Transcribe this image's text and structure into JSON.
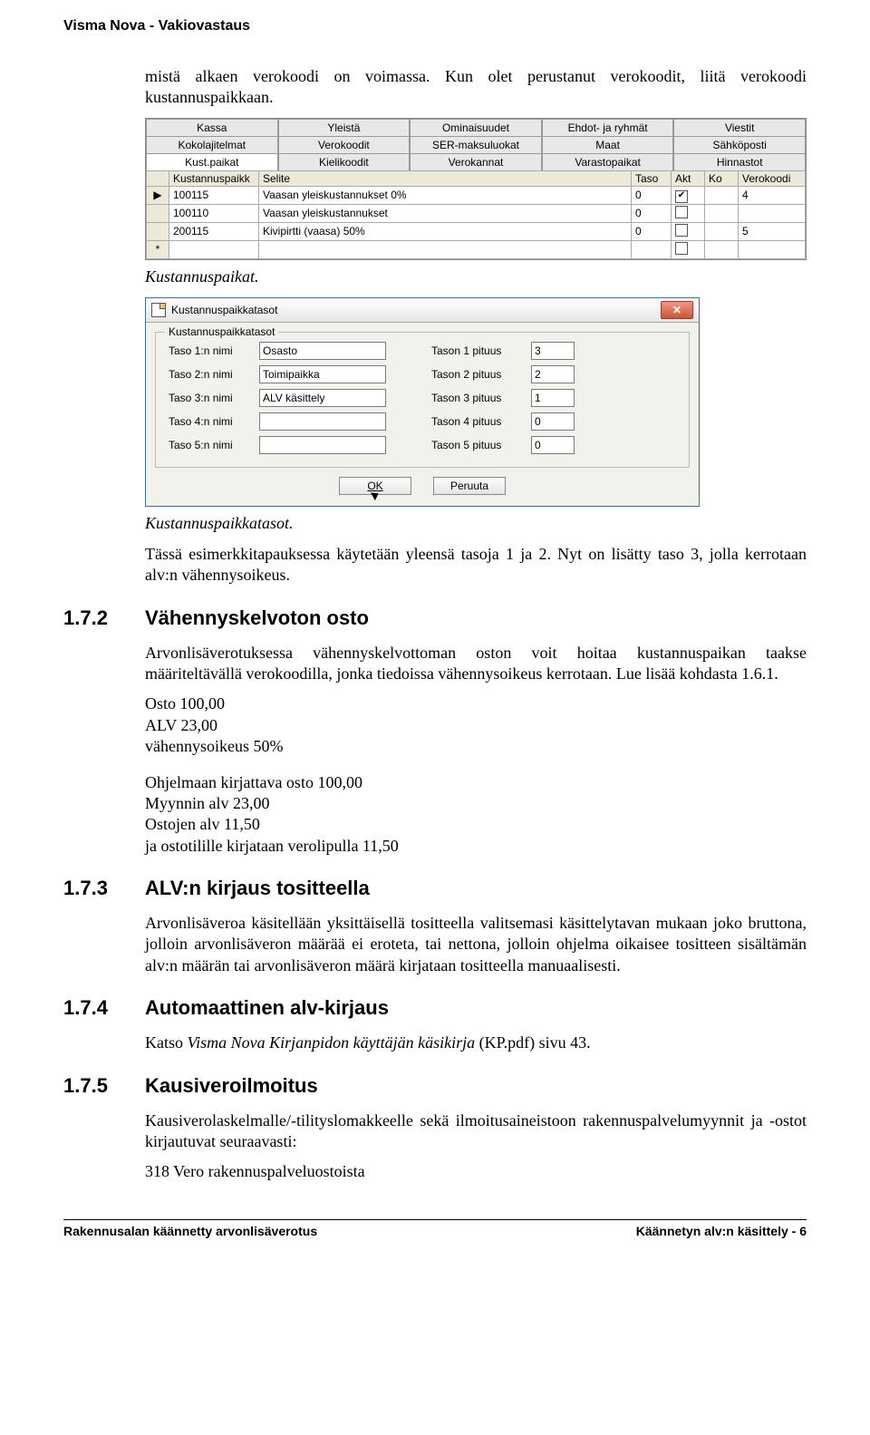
{
  "docHeader": "Visma Nova - Vakiovastaus",
  "intro": "mistä alkaen verokoodi on voimassa. Kun olet perustanut verokoodit, liitä verokoodi kustannuspaikkaan.",
  "screenshot1": {
    "tabs_row1": [
      "Kassa",
      "Yleistä",
      "Ominaisuudet",
      "Ehdot- ja ryhmät",
      "Viestit"
    ],
    "tabs_row2": [
      "Kokolajitelmat",
      "Verokoodit",
      "SER-maksuluokat",
      "Maat",
      "Sähköposti"
    ],
    "tabs_row3": [
      "Kust.paikat",
      "Kielikoodit",
      "Verokannat",
      "Varastopaikat",
      "Hinnastot"
    ],
    "selectedTab": "Kust.paikat",
    "columns": [
      "Kustannuspaikk",
      "Selite",
      "Taso",
      "Akt",
      "Ko",
      "Verokoodi"
    ],
    "rows": [
      {
        "kust": "100115",
        "selite": "Vaasan yleiskustannukset 0%",
        "taso": "0",
        "akt": true,
        "ko": "",
        "vero": "4",
        "marker": "▶"
      },
      {
        "kust": "100110",
        "selite": "Vaasan yleiskustannukset",
        "taso": "0",
        "akt": false,
        "ko": "",
        "vero": "",
        "marker": ""
      },
      {
        "kust": "200115",
        "selite": "Kivipirtti (vaasa) 50%",
        "taso": "0",
        "akt": false,
        "ko": "",
        "vero": "5",
        "marker": ""
      },
      {
        "kust": "",
        "selite": "",
        "taso": "",
        "akt": false,
        "ko": "",
        "vero": "",
        "marker": "*"
      }
    ]
  },
  "caption1": "Kustannuspaikat.",
  "dialog": {
    "title": "Kustannuspaikkatasot",
    "group": "Kustannuspaikkatasot",
    "rows": [
      {
        "nameLabel": "Taso 1:n nimi",
        "nameVal": "Osasto",
        "lenLabel": "Tason 1 pituus",
        "lenVal": "3"
      },
      {
        "nameLabel": "Taso 2:n nimi",
        "nameVal": "Toimipaikka",
        "lenLabel": "Tason 2 pituus",
        "lenVal": "2"
      },
      {
        "nameLabel": "Taso 3:n nimi",
        "nameVal": "ALV käsittely",
        "lenLabel": "Tason 3 pituus",
        "lenVal": "1"
      },
      {
        "nameLabel": "Taso 4:n nimi",
        "nameVal": "",
        "lenLabel": "Tason 4 pituus",
        "lenVal": "0"
      },
      {
        "nameLabel": "Taso 5:n nimi",
        "nameVal": "",
        "lenLabel": "Tason 5 pituus",
        "lenVal": "0"
      }
    ],
    "ok": "OK",
    "cancel": "Peruuta"
  },
  "caption2": "Kustannuspaikkatasot.",
  "para_tassa": "Tässä esimerkkitapauksessa käytetään yleensä tasoja 1 ja 2. Nyt on lisätty taso 3, jolla kerrotaan alv:n vähennysoikeus.",
  "s172": {
    "num": "1.7.2",
    "title": "Vähennyskelvoton osto",
    "p1": "Arvonlisäverotuksessa vähennyskelvottoman oston voit hoitaa kustannuspaikan taakse määriteltävällä verokoodilla, jonka tiedoissa vähennysoikeus kerrotaan. Lue lisää kohdasta 1.6.1.",
    "list1": [
      "Osto 100,00",
      "ALV 23,00",
      "vähennysoikeus 50%"
    ],
    "list2": [
      "Ohjelmaan kirjattava osto 100,00",
      "Myynnin alv 23,00",
      "Ostojen alv 11,50",
      "ja ostotilille kirjataan verolipulla 11,50"
    ]
  },
  "s173": {
    "num": "1.7.3",
    "title": "ALV:n kirjaus tositteella",
    "p1": "Arvonlisäveroa käsitellään yksittäisellä tositteella valitsemasi käsittelytavan mukaan joko bruttona, jolloin arvonlisäveron määrää ei eroteta, tai nettona, jolloin ohjelma oikaisee tositteen sisältämän alv:n määrän tai arvonlisäveron määrä kirjataan tositteella manuaalisesti."
  },
  "s174": {
    "num": "1.7.4",
    "title": "Automaattinen alv-kirjaus",
    "p1_prefix": "Katso ",
    "p1_em": "Visma Nova Kirjanpidon käyttäjän käsikirja",
    "p1_suffix": " (KP.pdf) sivu 43."
  },
  "s175": {
    "num": "1.7.5",
    "title": "Kausiveroilmoitus",
    "p1": "Kausiverolaskelmalle/-tilityslomakkeelle sekä ilmoitusaineistoon rakennuspalvelumyynnit ja -ostot kirjautuvat seuraavasti:",
    "p2": "318 Vero rakennuspalveluostoista"
  },
  "footer": {
    "left": "Rakennusalan käännetty arvonlisäverotus",
    "right": "Käännetyn alv:n käsittely - 6"
  }
}
